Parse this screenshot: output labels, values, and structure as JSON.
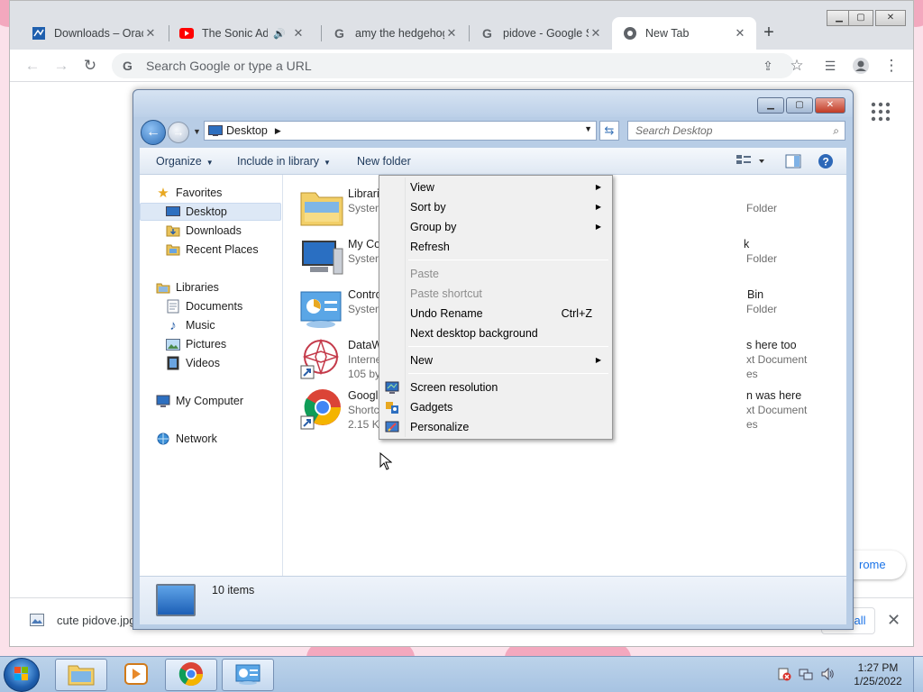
{
  "chrome": {
    "tabs": [
      {
        "title": "Downloads – Oracle VM VirtualBox",
        "icon": "virtualbox-icon"
      },
      {
        "title": "The Sonic Adventure",
        "icon": "youtube-icon",
        "audio": true
      },
      {
        "title": "amy the hedgehog",
        "icon": "google-icon"
      },
      {
        "title": "pidove - Google Search",
        "icon": "google-icon"
      },
      {
        "title": "New Tab",
        "icon": "chrome-icon",
        "active": true
      }
    ],
    "omnibox_placeholder": "Search Google or type a URL",
    "customize_pill": "rome",
    "download": {
      "file": "cute pidove.jpg",
      "show_all": "all"
    }
  },
  "explorer": {
    "address": "Desktop",
    "search_placeholder": "Search Desktop",
    "commands": {
      "organize": "Organize",
      "include_in_library": "Include in library",
      "new_folder": "New folder"
    },
    "nav": {
      "favorites": "Favorites",
      "desktop": "Desktop",
      "downloads": "Downloads",
      "recent_places": "Recent Places",
      "libraries": "Libraries",
      "documents": "Documents",
      "music": "Music",
      "pictures": "Pictures",
      "videos": "Videos",
      "my_computer": "My Computer",
      "network": "Network"
    },
    "files": [
      {
        "name": "Librari",
        "sub": "Systen"
      },
      {
        "name": "My Co",
        "sub": "Systen"
      },
      {
        "name": "Contro",
        "sub": "Systen"
      },
      {
        "name": "DataW",
        "sub": "Interne",
        "sub2": "105 by"
      },
      {
        "name": "Googl",
        "sub": "Shortc",
        "sub2": "2.15 Kl"
      }
    ],
    "files_right": [
      {
        "name": "",
        "sub": "Folder"
      },
      {
        "name": "k",
        "sub": "Folder"
      },
      {
        "name": "Bin",
        "sub": "Folder"
      },
      {
        "name": "s here too",
        "sub": "xt Document",
        "sub2": "es"
      },
      {
        "name": "n was here",
        "sub": "xt Document",
        "sub2": "es"
      }
    ],
    "item_count": "10 items"
  },
  "context_menu": {
    "view": "View",
    "sort_by": "Sort by",
    "group_by": "Group by",
    "refresh": "Refresh",
    "paste": "Paste",
    "paste_shortcut": "Paste shortcut",
    "undo_rename": "Undo Rename",
    "undo_shortcut": "Ctrl+Z",
    "next_background": "Next desktop background",
    "new": "New",
    "screen_resolution": "Screen resolution",
    "gadgets": "Gadgets",
    "personalize": "Personalize"
  },
  "taskbar": {
    "time": "1:27 PM",
    "date": "1/25/2022"
  }
}
